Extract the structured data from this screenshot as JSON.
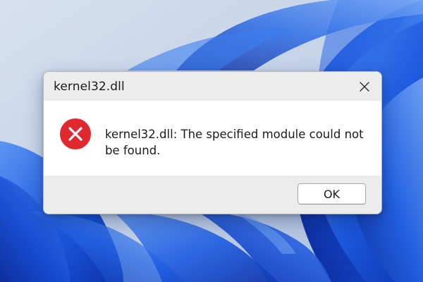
{
  "window": {
    "title": "kernel32.dll",
    "close_icon": "close-icon"
  },
  "dialog": {
    "icon": "error-icon",
    "message": "kernel32.dll: The specified module could not be found.",
    "ok_label": "OK"
  },
  "colors": {
    "error_red": "#e0282e",
    "dialog_background": "#ececec",
    "content_background": "#ffffff",
    "wallpaper_blue": "#1a56d6"
  }
}
